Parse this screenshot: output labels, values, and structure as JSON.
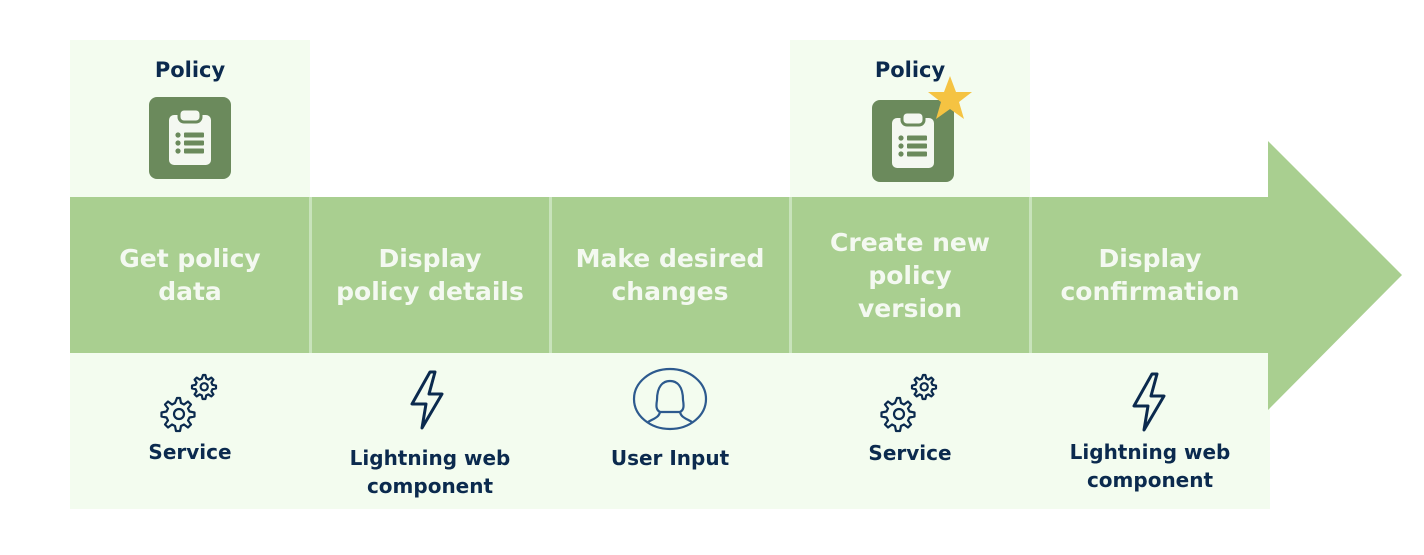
{
  "diagram": {
    "colors": {
      "arrow": "#a9cf90",
      "panel": "#f3fcef",
      "divider": "#c8e3bb",
      "step_text": "#f4f9f1",
      "label_text": "#0b2a4e",
      "policy_icon_bg": "#6b8a5c",
      "star": "#f5c342"
    },
    "steps": [
      {
        "label": "Get policy\ndata",
        "top": {
          "label": "Policy",
          "icon": "clipboard-list-icon",
          "badge": null
        },
        "bottom": {
          "label": "Service",
          "icon": "gears-icon"
        }
      },
      {
        "label": "Display\npolicy details",
        "top": null,
        "bottom": {
          "label": "Lightning web\ncomponent",
          "icon": "lightning-bolt-icon"
        }
      },
      {
        "label": "Make desired\nchanges",
        "top": null,
        "bottom": {
          "label": "User Input",
          "icon": "user-avatar-icon"
        }
      },
      {
        "label": "Create new\npolicy\nversion",
        "top": {
          "label": "Policy",
          "icon": "clipboard-list-icon",
          "badge": "star-icon"
        },
        "bottom": {
          "label": "Service",
          "icon": "gears-icon"
        }
      },
      {
        "label": "Display\nconfirmation",
        "top": null,
        "bottom": {
          "label": "Lightning web\ncomponent",
          "icon": "lightning-bolt-icon"
        }
      }
    ]
  }
}
